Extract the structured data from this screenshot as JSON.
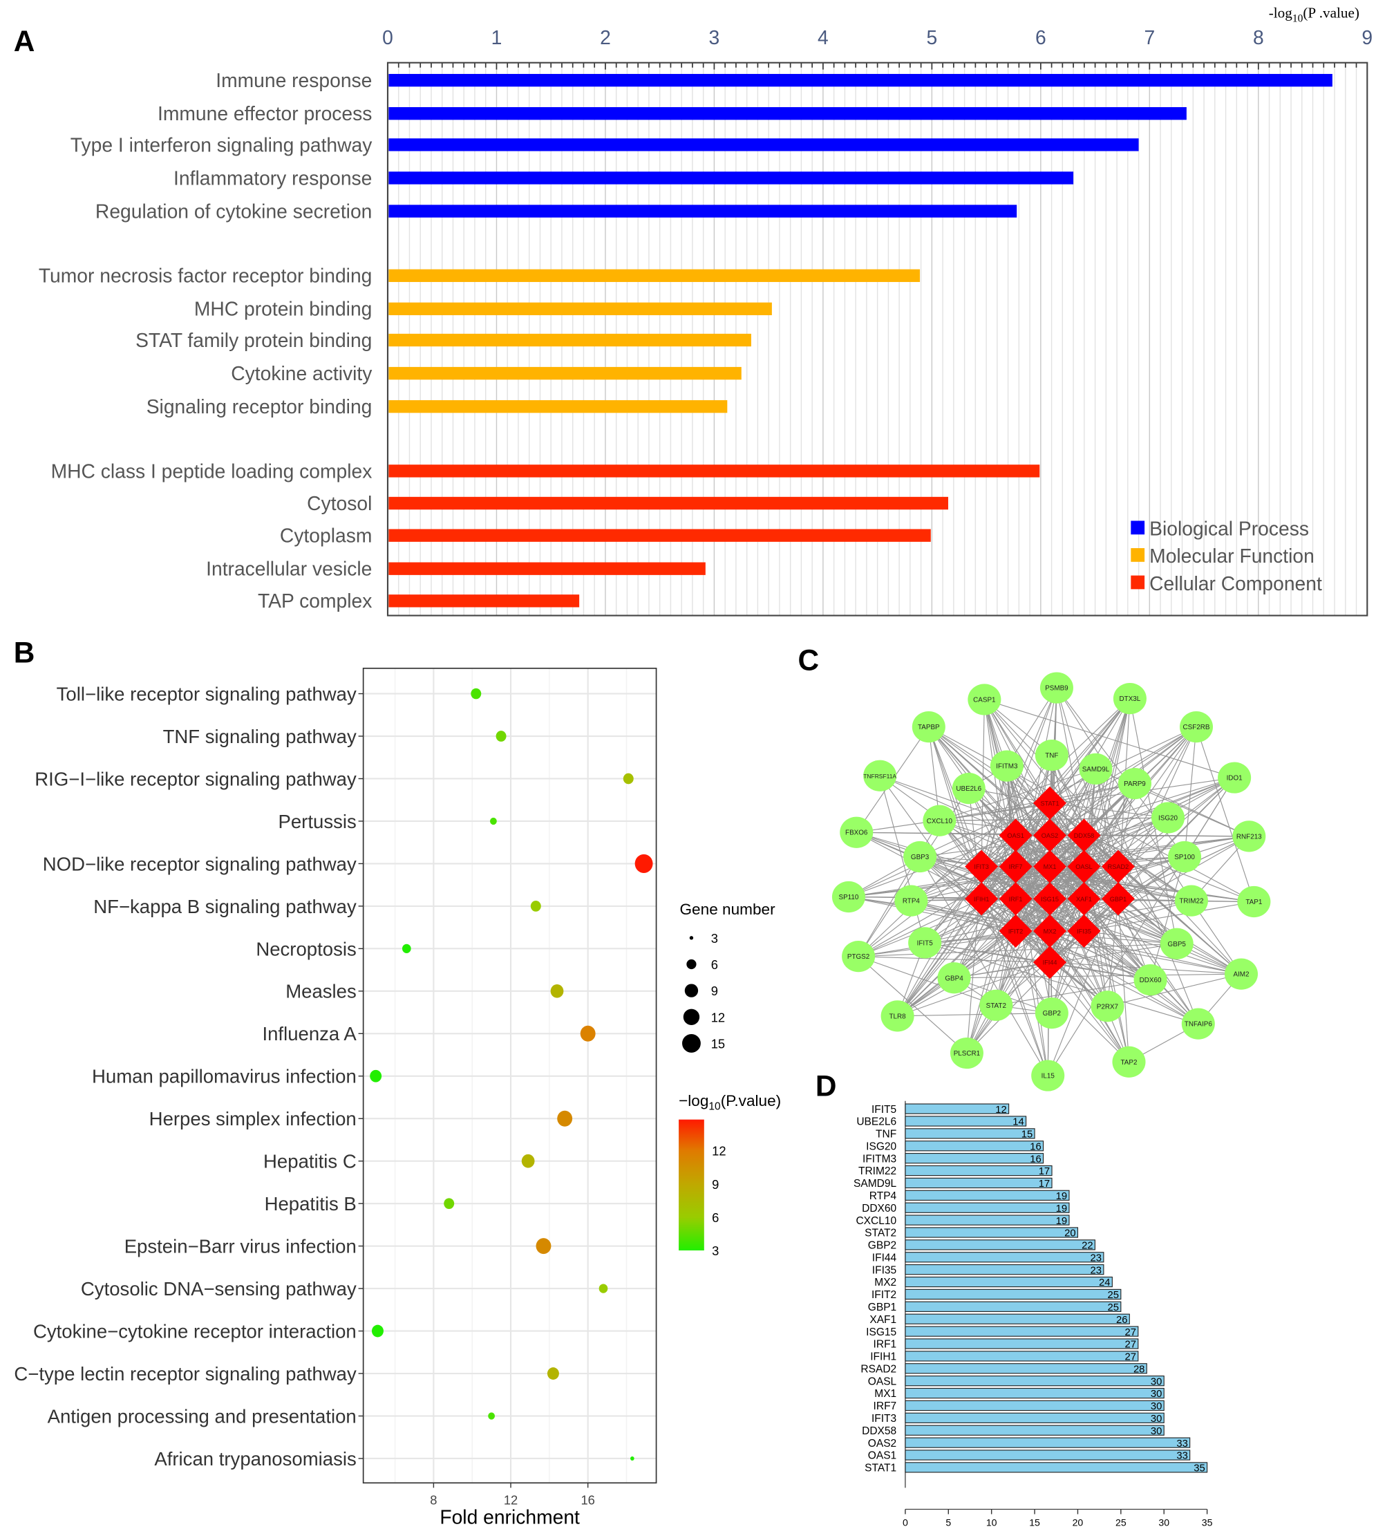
{
  "panels": {
    "a": "A",
    "b": "B",
    "c": "C",
    "d": "D"
  },
  "chart_data": [
    {
      "panel": "A",
      "type": "bar",
      "orientation": "horizontal",
      "xlabel": "-log10(P .value)",
      "xlabel_main": "-log",
      "xlabel_sub": "10",
      "xlabel_tail": "(P .value)",
      "xlim": [
        0,
        9
      ],
      "xticks": [
        "0",
        "1",
        "2",
        "3",
        "4",
        "5",
        "6",
        "7",
        "8",
        "9"
      ],
      "grid": true,
      "legend_position": "bottom-right",
      "series": [
        {
          "name": "Biological Process",
          "color": "#0000ff",
          "categories": [
            "Immune response",
            "Immune effector process",
            "Type I interferon signaling pathway",
            "Inflammatory response",
            "Regulation of cytokine secretion"
          ],
          "values": [
            8.68,
            7.34,
            6.9,
            6.3,
            5.78
          ]
        },
        {
          "name": "Molecular Function",
          "color": "#ffb300",
          "categories": [
            "Tumor necrosis factor receptor binding",
            "MHC protein binding",
            "STAT family protein binding",
            "Cytokine activity",
            "Signaling receptor binding"
          ],
          "values": [
            4.89,
            3.53,
            3.34,
            3.25,
            3.12
          ]
        },
        {
          "name": "Cellular Component",
          "color": "#ff2a00",
          "categories": [
            "MHC class I peptide loading complex",
            "Cytosol",
            "Cytoplasm",
            "Intracellular vesicle",
            "TAP complex"
          ],
          "values": [
            5.99,
            5.15,
            4.99,
            2.92,
            1.76
          ]
        }
      ]
    },
    {
      "panel": "B",
      "type": "scatter",
      "xlabel": "Fold enrichment",
      "xlim": [
        4.3,
        19.6
      ],
      "xticks": [
        8,
        12,
        16
      ],
      "grid": true,
      "size_legend_title": "Gene number",
      "size_legend_values": [
        3,
        6,
        9,
        12,
        15
      ],
      "color_legend_title_main": "−log",
      "color_legend_title_sub": "10",
      "color_legend_title_tail": "(P.value)",
      "color_legend_ticks": [
        3,
        6,
        9,
        12
      ],
      "color_range": [
        3,
        14.8
      ],
      "color_low": "#22ee00",
      "color_high": "#ff1a00",
      "points": [
        {
          "term": "Toll−like receptor signaling pathway",
          "fold_enrichment": 10.2,
          "gene_number": 6,
          "neg_log10_p": 4
        },
        {
          "term": "TNF signaling pathway",
          "fold_enrichment": 11.5,
          "gene_number": 6,
          "neg_log10_p": 5
        },
        {
          "term": "RIG−I−like receptor signaling pathway",
          "fold_enrichment": 18.1,
          "gene_number": 6,
          "neg_log10_p": 7
        },
        {
          "term": "Pertussis",
          "fold_enrichment": 11.1,
          "gene_number": 4,
          "neg_log10_p": 4
        },
        {
          "term": "NOD−like receptor signaling pathway",
          "fold_enrichment": 18.9,
          "gene_number": 13,
          "neg_log10_p": 14.8
        },
        {
          "term": "NF−kappa B signaling pathway",
          "fold_enrichment": 13.3,
          "gene_number": 6,
          "neg_log10_p": 6
        },
        {
          "term": "Necroptosis",
          "fold_enrichment": 6.6,
          "gene_number": 5,
          "neg_log10_p": 3
        },
        {
          "term": "Measles",
          "fold_enrichment": 14.4,
          "gene_number": 8,
          "neg_log10_p": 8
        },
        {
          "term": "Influenza A",
          "fold_enrichment": 16.0,
          "gene_number": 10,
          "neg_log10_p": 11.5
        },
        {
          "term": "Human papillomavirus infection",
          "fold_enrichment": 5.0,
          "gene_number": 7,
          "neg_log10_p": 3
        },
        {
          "term": "Herpes simplex infection",
          "fold_enrichment": 14.8,
          "gene_number": 10,
          "neg_log10_p": 11
        },
        {
          "term": "Hepatitis C",
          "fold_enrichment": 12.9,
          "gene_number": 8,
          "neg_log10_p": 8
        },
        {
          "term": "Hepatitis B",
          "fold_enrichment": 8.8,
          "gene_number": 6,
          "neg_log10_p": 5
        },
        {
          "term": "Epstein−Barr virus infection",
          "fold_enrichment": 13.7,
          "gene_number": 10,
          "neg_log10_p": 11
        },
        {
          "term": "Cytosolic DNA−sensing pathway",
          "fold_enrichment": 16.8,
          "gene_number": 5,
          "neg_log10_p": 6
        },
        {
          "term": "Cytokine−cytokine receptor interaction",
          "fold_enrichment": 5.1,
          "gene_number": 7,
          "neg_log10_p": 3
        },
        {
          "term": "C−type lectin receptor signaling pathway",
          "fold_enrichment": 14.2,
          "gene_number": 7,
          "neg_log10_p": 8
        },
        {
          "term": "Antigen processing and presentation",
          "fold_enrichment": 11.0,
          "gene_number": 4,
          "neg_log10_p": 4
        },
        {
          "term": "African trypanosomiasis",
          "fold_enrichment": 18.3,
          "gene_number": 2,
          "neg_log10_p": 3
        }
      ]
    },
    {
      "panel": "D",
      "type": "bar",
      "orientation": "horizontal",
      "xlim": [
        0,
        35
      ],
      "xticks": [
        0,
        5,
        10,
        15,
        20,
        25,
        30,
        35
      ],
      "bar_color": "#87ceeb",
      "categories": [
        "IFIT5",
        "UBE2L6",
        "TNF",
        "ISG20",
        "IFITM3",
        "TRIM22",
        "SAMD9L",
        "RTP4",
        "DDX60",
        "CXCL10",
        "STAT2",
        "GBP2",
        "IFI44",
        "IFI35",
        "MX2",
        "IFIT2",
        "GBP1",
        "XAF1",
        "ISG15",
        "IRF1",
        "IFIH1",
        "RSAD2",
        "OASL",
        "MX1",
        "IRF7",
        "IFIT3",
        "DDX58",
        "OAS2",
        "OAS1",
        "STAT1"
      ],
      "values": [
        12,
        14,
        15,
        16,
        16,
        17,
        17,
        19,
        19,
        19,
        20,
        22,
        23,
        23,
        24,
        25,
        25,
        26,
        27,
        27,
        27,
        28,
        30,
        30,
        30,
        30,
        30,
        33,
        33,
        35
      ]
    }
  ],
  "network": {
    "hub_color": "#ff0000",
    "node_color": "#99ff66",
    "hub_genes": [
      "STAT1",
      "OAS1",
      "OAS2",
      "DDX58",
      "IFIT3",
      "IRF7",
      "MX1",
      "OASL",
      "RSAD2",
      "IFIH1",
      "IRF1",
      "ISG15",
      "XAF1",
      "GBP1",
      "IFIT2",
      "MX2",
      "IFI35",
      "IFI44"
    ],
    "other_genes": [
      "PSMB9",
      "CASP1",
      "DTX3L",
      "TAPBP",
      "CSF2RB",
      "TNF",
      "IFITM3",
      "SAMD9L",
      "TNFRSF11A",
      "UBE2L6",
      "PARP9",
      "IDO1",
      "CXCL10",
      "ISG20",
      "FBXO6",
      "RNF213",
      "GBP3",
      "SP100",
      "SP110",
      "RTP4",
      "TRIM22",
      "TAP1",
      "IFIT5",
      "GBP5",
      "PTGS2",
      "GBP4",
      "DDX60",
      "AIM2",
      "STAT2",
      "GBP2",
      "P2RX7",
      "TLR8",
      "TNFAIP6",
      "PLSCR1",
      "TAP2",
      "IL15"
    ]
  }
}
